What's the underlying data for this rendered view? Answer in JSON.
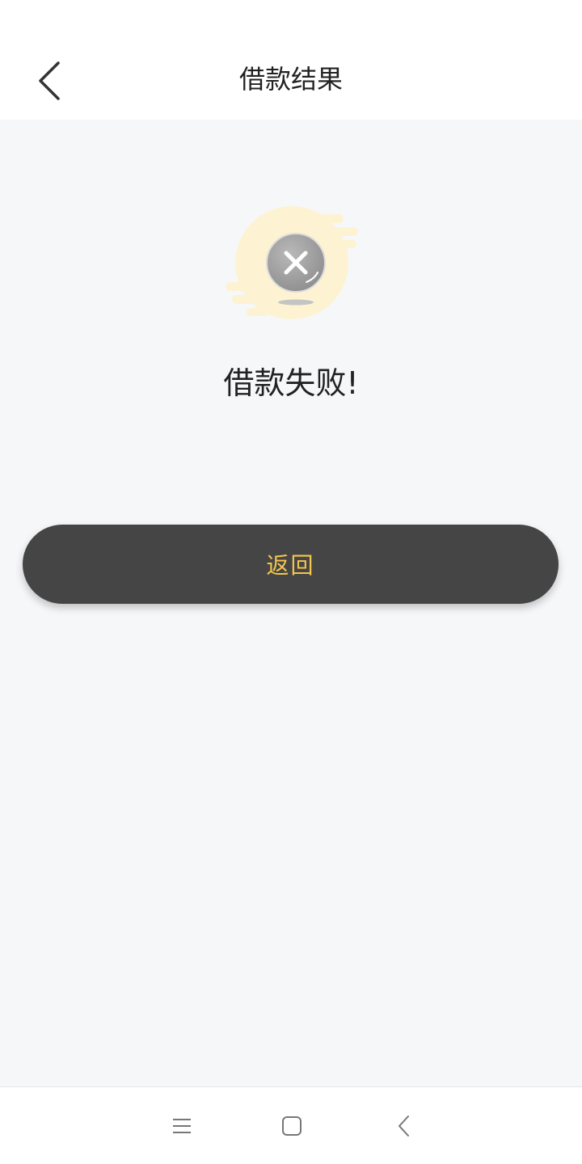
{
  "header": {
    "title": "借款结果",
    "back_icon": "chevron-left-icon"
  },
  "result": {
    "status": "failed",
    "message": "借款失败!",
    "icon": "failure-x-icon",
    "accent_color": "#f5c64d",
    "illustration_bg_color": "#fdf2cc"
  },
  "actions": {
    "return_label": "返回",
    "button_color": "#454545"
  },
  "system_nav": {
    "menu_icon": "menu-icon",
    "home_icon": "home-square-icon",
    "back_icon": "back-chevron-icon"
  }
}
